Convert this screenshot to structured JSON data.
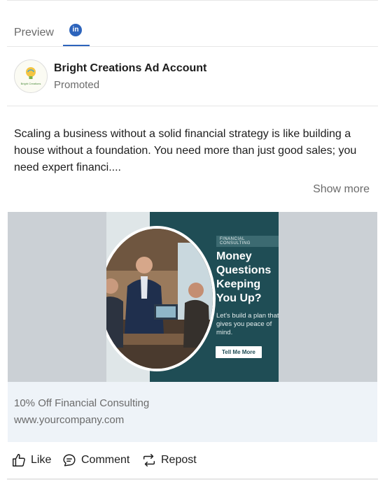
{
  "tabs": {
    "preview_label": "Preview",
    "network_icon": "linkedin-icon",
    "network_icon_text": "in"
  },
  "account": {
    "name": "Bright Creations Ad Account",
    "subtitle": "Promoted",
    "avatar_text": "Bright Creations"
  },
  "post": {
    "text": "Scaling a business without a solid financial strategy is like building a house without a foundation. You need more than just good sales; you need expert financi....",
    "show_more": "Show more"
  },
  "creative": {
    "badge": "FINANCIAL CONSULTING",
    "headline": "Money Questions Keeping You Up?",
    "subcopy": "Let's build a plan that gives you peace of mind.",
    "cta": "Tell Me More"
  },
  "caption": {
    "title": "10% Off Financial Consulting",
    "url": "www.yourcompany.com"
  },
  "actions": {
    "like": "Like",
    "comment": "Comment",
    "repost": "Repost"
  },
  "colors": {
    "accent": "#2d64bc",
    "ad_background": "#1f4d55",
    "caption_background": "#eef3f8"
  }
}
